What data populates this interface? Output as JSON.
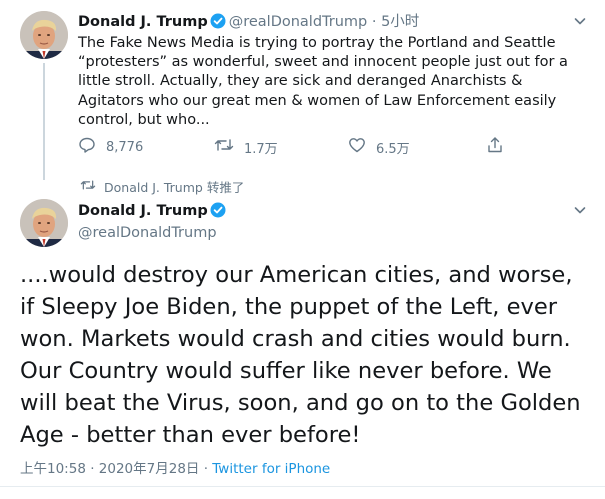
{
  "tweet1": {
    "name": "Donald J. Trump",
    "handle": "@realDonaldTrump",
    "separator": "·",
    "time": "5小时",
    "text": "The Fake News Media is trying to portray the Portland and Seattle “protesters” as wonderful, sweet and innocent people just out for a little stroll. Actually, they are sick and deranged Anarchists & Agitators who our great men & women of Law Enforcement easily control, but who...",
    "replies": "8,776",
    "retweets": "1.7万",
    "likes": "6.5万"
  },
  "retweet_notice": "Donald J. Trump 转推了",
  "tweet2": {
    "name": "Donald J. Trump",
    "handle": "@realDonaldTrump",
    "text": "....would destroy our American cities, and worse, if Sleepy Joe Biden, the puppet of the Left, ever won. Markets would crash and cities would burn. Our Country would suffer like never before. We will beat the Virus, soon, and go on to the Golden Age - better than ever before!",
    "timestamp": "上午10:58 · 2020年7月28日 · ",
    "source": "Twitter for iPhone"
  },
  "colors": {
    "accent": "#1b95e0",
    "verified": "#1da1f2",
    "muted": "#657786",
    "text": "#14171a"
  },
  "icons": [
    "verified-badge-icon",
    "chevron-down-icon",
    "reply-icon",
    "retweet-icon",
    "like-icon",
    "share-icon"
  ]
}
